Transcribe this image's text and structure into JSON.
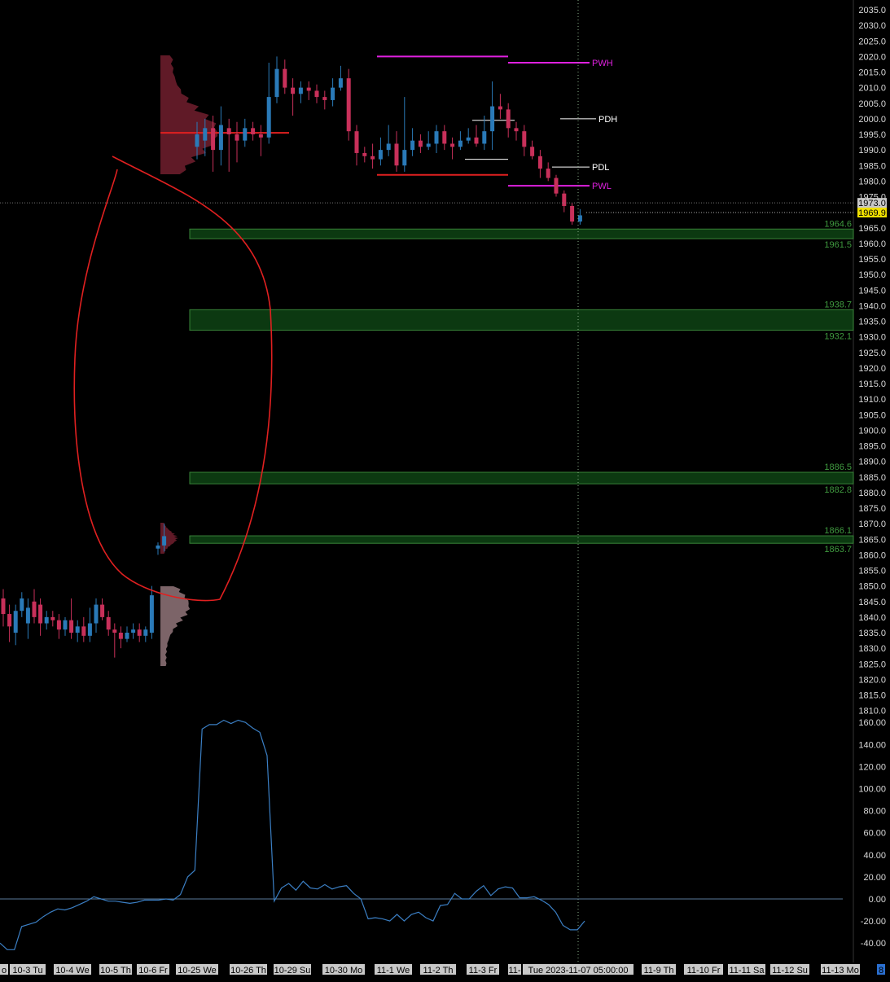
{
  "chart_data": [
    {
      "type": "candlestick",
      "ylim": [
        1810,
        2037
      ],
      "y_ticks": [
        "2035.0",
        "2030.0",
        "2025.0",
        "2020.0",
        "2015.0",
        "2010.0",
        "2005.0",
        "2000.0",
        "1995.0",
        "1990.0",
        "1985.0",
        "1980.0",
        "1975.0",
        "1970.0",
        "1965.0",
        "1960.0",
        "1955.0",
        "1950.0",
        "1945.0",
        "1940.0",
        "1935.0",
        "1930.0",
        "1925.0",
        "1920.0",
        "1915.0",
        "1910.0",
        "1905.0",
        "1900.0",
        "1895.0",
        "1890.0",
        "1885.0",
        "1880.0",
        "1875.0",
        "1870.0",
        "1865.0",
        "1860.0",
        "1855.0",
        "1850.0",
        "1845.0",
        "1840.0",
        "1835.0",
        "1830.0",
        "1825.0",
        "1820.0",
        "1815.0",
        "1810.0"
      ],
      "last_price": "1969.9",
      "crosshair_price": "1973.0",
      "levels": [
        {
          "label": "PWH",
          "value": 2018,
          "color": "#e020e0"
        },
        {
          "label": "PDH",
          "value": 2000,
          "color": "#ffffff"
        },
        {
          "label": "PDL",
          "value": 1984.5,
          "color": "#ffffff"
        },
        {
          "label": "PWL",
          "value": 1978.5,
          "color": "#e020e0"
        }
      ],
      "zones": [
        {
          "top": 1964.6,
          "bottom": 1961.5,
          "top_label": "1964.6",
          "bottom_label": "1961.5"
        },
        {
          "top": 1938.7,
          "bottom": 1932.1,
          "top_label": "1938.7",
          "bottom_label": "1932.1"
        },
        {
          "top": 1886.5,
          "bottom": 1882.8,
          "top_label": "1886.5",
          "bottom_label": "1882.8"
        },
        {
          "top": 1866.1,
          "bottom": 1863.7,
          "top_label": "1866.1",
          "bottom_label": "1863.7"
        }
      ],
      "poc_level": 1995.5,
      "weekly_range_lines": [
        2020,
        1982
      ],
      "candles": [
        [
          1846,
          1841,
          1849,
          1837
        ],
        [
          1841,
          1837,
          1844,
          1832
        ],
        [
          1835,
          1842,
          1844,
          1831
        ],
        [
          1842,
          1846,
          1848,
          1840
        ],
        [
          1838,
          1843,
          1846,
          1833
        ],
        [
          1845,
          1840,
          1849,
          1838
        ],
        [
          1844,
          1838,
          1846,
          1834
        ],
        [
          1838,
          1840,
          1842,
          1836
        ],
        [
          1840,
          1839,
          1842,
          1837
        ],
        [
          1839,
          1836,
          1841,
          1833
        ],
        [
          1836,
          1839,
          1840,
          1834
        ],
        [
          1839,
          1835,
          1846,
          1833
        ],
        [
          1835,
          1837,
          1839,
          1832
        ],
        [
          1837,
          1834,
          1840,
          1832
        ],
        [
          1834,
          1838,
          1843,
          1832
        ],
        [
          1838,
          1844,
          1846,
          1835
        ],
        [
          1844,
          1840,
          1846,
          1839
        ],
        [
          1840,
          1836,
          1842,
          1834
        ],
        [
          1836,
          1835,
          1838,
          1827
        ],
        [
          1835,
          1833,
          1837,
          1830
        ],
        [
          1833,
          1835,
          1837,
          1832
        ],
        [
          1835,
          1836,
          1838,
          1833
        ],
        [
          1836,
          1834,
          1838,
          1832
        ],
        [
          1834,
          1836,
          1837,
          1832
        ],
        [
          1835,
          1847,
          1850,
          1833
        ],
        [
          1862,
          1863,
          1864,
          1860
        ],
        [
          1863,
          1866,
          1870,
          1861
        ],
        [
          1991,
          1995,
          1999,
          1987
        ],
        [
          1993,
          1997,
          2000,
          1988
        ],
        [
          1997,
          1990,
          2001,
          1983
        ],
        [
          1990,
          1998,
          2004,
          1985
        ],
        [
          1997,
          1995,
          2000,
          1983
        ],
        [
          1995,
          1993,
          1999,
          1986
        ],
        [
          1993,
          1997,
          2000,
          1991
        ],
        [
          1997,
          1995,
          1999,
          1993
        ],
        [
          1995,
          1994,
          1998,
          1988
        ],
        [
          1994,
          2007,
          2018,
          1992
        ],
        [
          2007,
          2016,
          2020,
          2005
        ],
        [
          2016,
          2010,
          2019,
          2008
        ],
        [
          2010,
          2008,
          2013,
          2001
        ],
        [
          2008,
          2010,
          2012,
          2005
        ],
        [
          2010,
          2009,
          2012,
          2006
        ],
        [
          2009,
          2007,
          2011,
          2005
        ],
        [
          2007,
          2006,
          2009,
          2003
        ],
        [
          2006,
          2010,
          2013,
          2004
        ],
        [
          2010,
          2013,
          2017,
          2009
        ],
        [
          2013,
          1996,
          2016,
          1993
        ],
        [
          1996,
          1989,
          1998,
          1985
        ],
        [
          1989,
          1988,
          1991,
          1986
        ],
        [
          1988,
          1987,
          1992,
          1984
        ],
        [
          1987,
          1990,
          1994,
          1985
        ],
        [
          1990,
          1992,
          1998,
          1988
        ],
        [
          1992,
          1985,
          1996,
          1983
        ],
        [
          1985,
          1990,
          2007,
          1983
        ],
        [
          1990,
          1993,
          1997,
          1988
        ],
        [
          1993,
          1991,
          1995,
          1989
        ],
        [
          1991,
          1992,
          1996,
          1990
        ],
        [
          1992,
          1996,
          1998,
          1989
        ],
        [
          1996,
          1992,
          1998,
          1990
        ],
        [
          1992,
          1991,
          1994,
          1987
        ],
        [
          1991,
          1993,
          1996,
          1990
        ],
        [
          1993,
          1994,
          1997,
          1992
        ],
        [
          1994,
          1992,
          1998,
          1991
        ],
        [
          1992,
          1996,
          2001,
          1990
        ],
        [
          1996,
          2004,
          2012,
          1990
        ],
        [
          2004,
          2003,
          2008,
          2000
        ],
        [
          2003,
          1997,
          2005,
          1994
        ],
        [
          1997,
          1996,
          1999,
          1993
        ],
        [
          1996,
          1991,
          1998,
          1988
        ],
        [
          1991,
          1988,
          1993,
          1987
        ],
        [
          1988,
          1984,
          1990,
          1981
        ],
        [
          1984,
          1981,
          1986,
          1980
        ],
        [
          1981,
          1976,
          1982,
          1975
        ],
        [
          1976,
          1972,
          1977,
          1970
        ],
        [
          1972,
          1967,
          1973,
          1966
        ],
        [
          1967,
          1969,
          1971,
          1966
        ]
      ],
      "indicator": {
        "ylim": [
          -45,
          165
        ],
        "y_ticks": [
          "160.00",
          "140.00",
          "120.00",
          "100.00",
          "80.00",
          "60.00",
          "40.00",
          "20.00",
          "0.00",
          "-20.00",
          "-40.00"
        ],
        "zero_line": 0,
        "values": [
          -40,
          -46,
          -46,
          -25,
          -23,
          -21,
          -16,
          -12,
          -9,
          -10,
          -8,
          -5,
          -2,
          2,
          0,
          -2,
          -2,
          -3,
          -4,
          -3,
          -1,
          -1,
          -1,
          0,
          -1,
          4,
          20,
          26,
          154,
          158,
          158,
          162,
          159,
          162,
          160,
          155,
          151,
          130,
          -2,
          10,
          14,
          8,
          16,
          10,
          9,
          13,
          9,
          11,
          12,
          5,
          0,
          -18,
          -17,
          -18,
          -20,
          -14,
          -20,
          -14,
          -12,
          -17,
          -20,
          -6,
          -5,
          5,
          0,
          0,
          7,
          12,
          3,
          9,
          11,
          10,
          1,
          1,
          2,
          -1,
          -5,
          -12,
          -24,
          -28,
          -28,
          -20
        ]
      },
      "x_labels": [
        "o",
        "10-3 Tu",
        "10-4 We",
        "10-5 Th",
        "10-6 Fr",
        "10-25 We",
        "10-26 Th",
        "10-29 Su",
        "10-30 Mo",
        "11-1 We",
        "11-2 Th",
        "11-3 Fr",
        "11-",
        "Tue 2023-11-07  05:00:00",
        "11-9 Th",
        "11-10 Fr",
        "11-11 Sa",
        "11-12 Su",
        "11-13 Mo",
        "8"
      ]
    }
  ]
}
